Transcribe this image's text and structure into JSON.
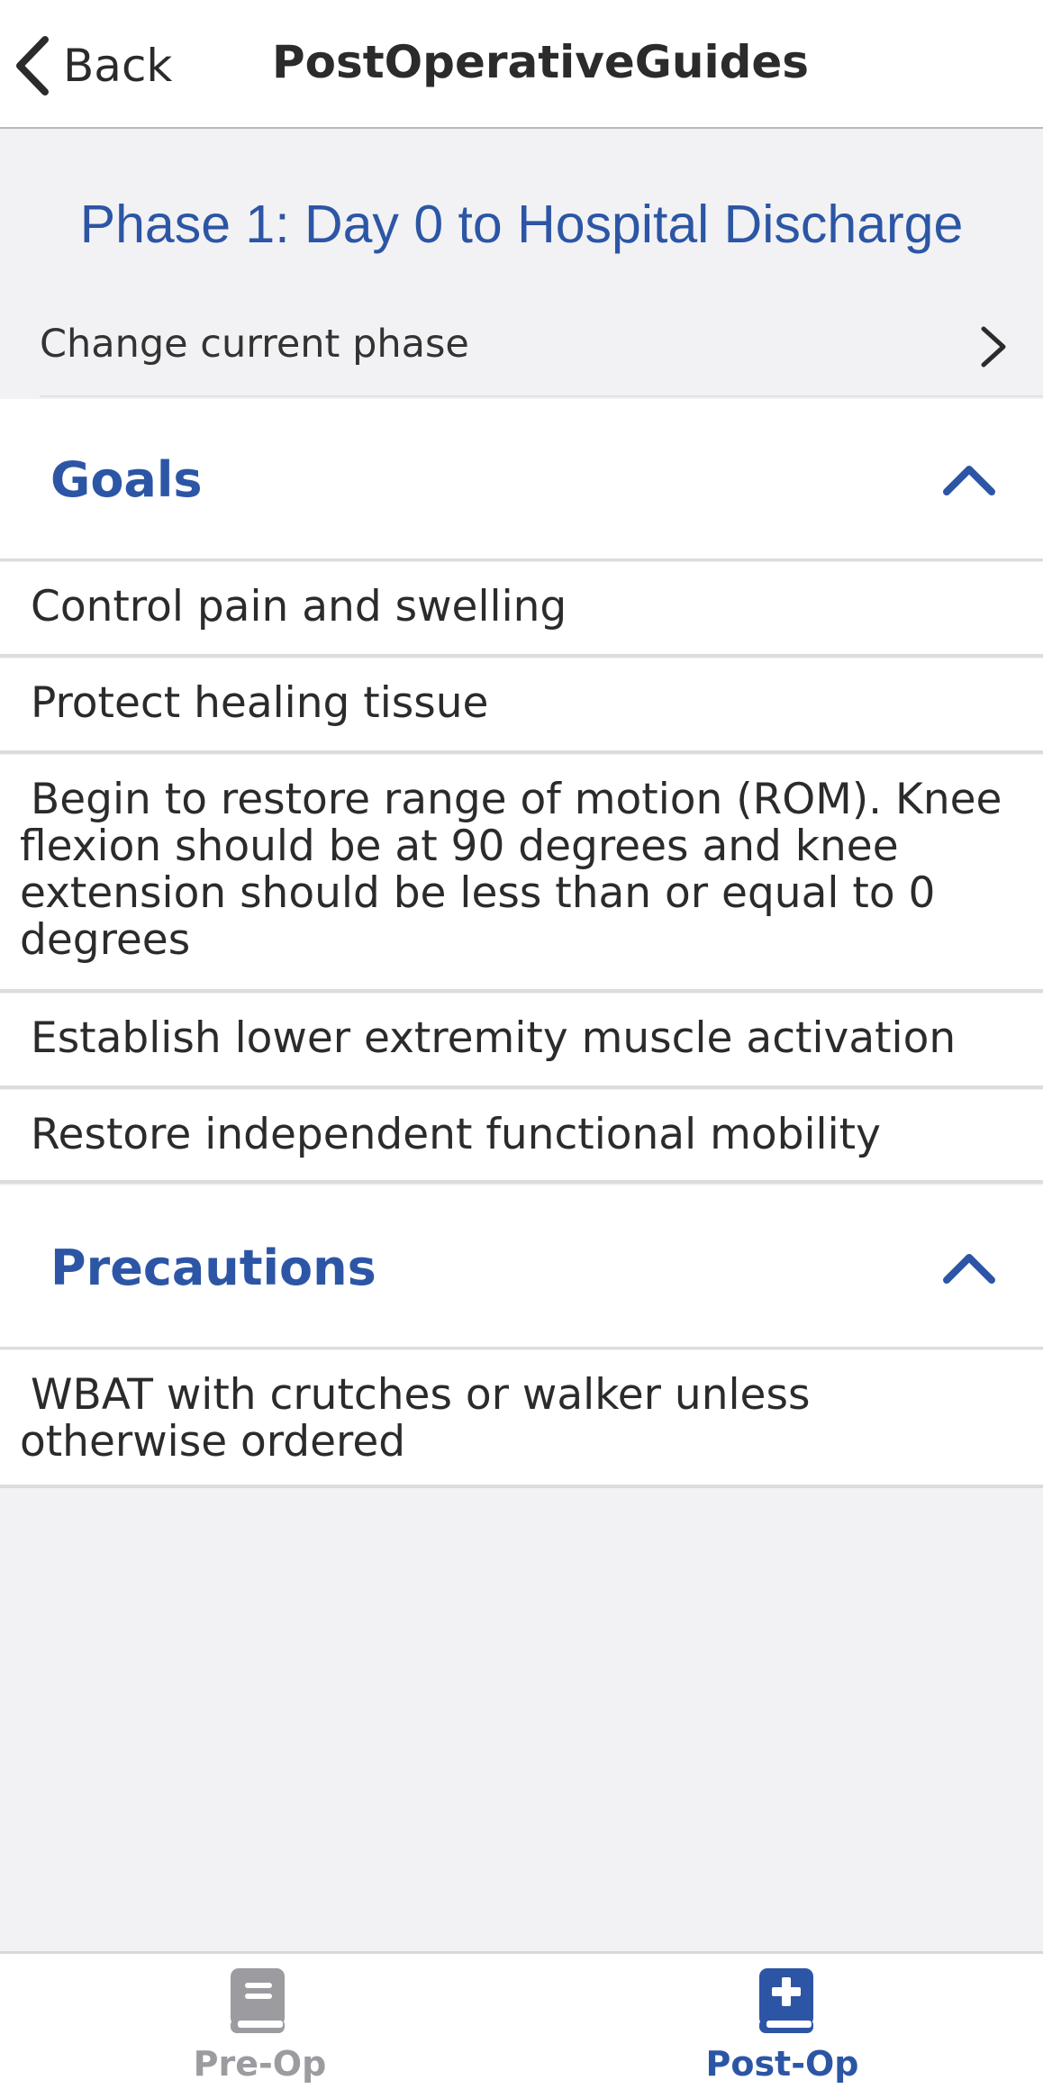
{
  "nav": {
    "back_label": "Back",
    "title": "PostOperativeGuides"
  },
  "phase": {
    "title": "Phase 1: Day 0 to Hospital Discharge",
    "change_label": "Change current phase"
  },
  "sections": {
    "goals": {
      "title": "Goals",
      "expanded": true,
      "items": [
        "Control pain and swelling",
        "Protect healing tissue",
        "Begin to restore range of motion (ROM). Knee flexion should be at 90 degrees and knee extension should be less than or equal to 0 degrees",
        "Establish lower extremity muscle activation",
        "Restore independent functional mobility"
      ]
    },
    "precautions": {
      "title": "Precautions",
      "expanded": true,
      "items": [
        "WBAT with crutches or walker unless otherwise ordered"
      ]
    }
  },
  "tabs": {
    "preop_label": "Pre-Op",
    "postop_label": "Post-Op",
    "selected": "Post-Op"
  },
  "colors": {
    "accent": "#2c56a5",
    "inactive_tab": "#9b9ba0",
    "background": "#f2f2f4"
  }
}
